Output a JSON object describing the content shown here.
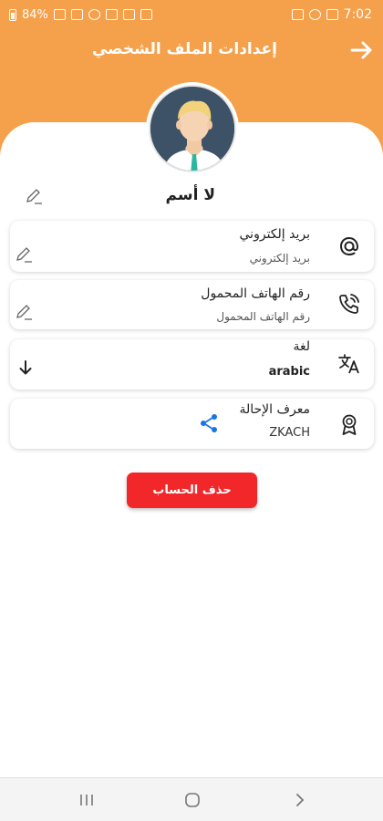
{
  "status_bar": {
    "battery_percent": "84%",
    "time": "7:02"
  },
  "header": {
    "title": "إعدادات الملف الشخصي",
    "back_icon": "arrow-right-icon",
    "background_color": "#f5a04a"
  },
  "profile": {
    "avatar_icon": "user-avatar-icon",
    "name": "لا أسم"
  },
  "fields": {
    "email": {
      "title": "بريد إلكتروني",
      "value": "بريد إلكتروني",
      "icon": "at-sign-icon"
    },
    "phone": {
      "title": "رقم الهاتف المحمول",
      "value": "رقم الهاتف المحمول",
      "icon": "phone-call-icon"
    },
    "language": {
      "title": "لغة",
      "value": "arabic",
      "icon": "translate-icon"
    },
    "referral": {
      "title": "معرف الإحالة",
      "value": "ZKACH",
      "icon": "award-ribbon-icon",
      "share_color": "#1a73e8"
    }
  },
  "actions": {
    "delete_account": "حذف الحساب",
    "delete_color": "#f2272a"
  }
}
